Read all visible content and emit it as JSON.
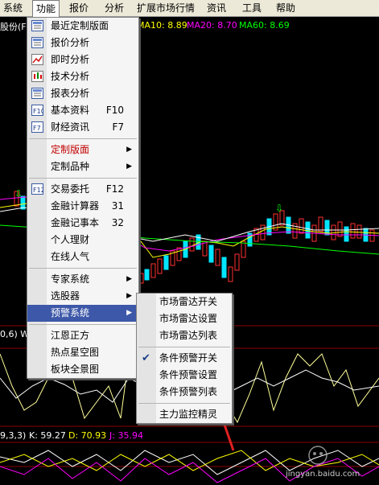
{
  "menubar": {
    "items": [
      "系统",
      "功能",
      "报价",
      "分析",
      "扩展市场行情",
      "资讯",
      "工具",
      "帮助"
    ],
    "active": "功能"
  },
  "chart_labels": {
    "stock": "股份(F",
    "ma10": "MA10: 8.89",
    "ma20": "MA20: 8.70",
    "ma60": "MA60: 8.69",
    "ind1": "0,6) W",
    "kdj_params": "9,3,3)",
    "k": "K: 59.27",
    "d": "D: 70.93",
    "j": "J: 35.94"
  },
  "colors": {
    "ma10": "#ffff00",
    "ma20": "#ff00ff",
    "ma60": "#00ff00",
    "highlight": "#3d58a8",
    "menu_red": "#c00000",
    "arrow": "#e02020"
  },
  "function_menu": {
    "items": [
      {
        "label": "最近定制版面",
        "icon": "layout-icon"
      },
      {
        "label": "报价分析",
        "icon": "quote-icon"
      },
      {
        "label": "即时分析",
        "icon": "line-chart-icon"
      },
      {
        "label": "技术分析",
        "icon": "candle-icon"
      },
      {
        "label": "报表分析",
        "icon": "report-icon"
      },
      {
        "label": "基本资料",
        "shortcut": "F10",
        "icon": "f10-icon"
      },
      {
        "label": "财经资讯",
        "shortcut": "F7",
        "icon": "f7-icon"
      },
      {
        "sep": true
      },
      {
        "label": "定制版面",
        "red": true,
        "submenu": true
      },
      {
        "label": "定制品种",
        "submenu": true
      },
      {
        "sep": true
      },
      {
        "label": "交易委托",
        "shortcut": "F12",
        "icon": "f12-icon"
      },
      {
        "label": "金融计算器",
        "shortcut": "31"
      },
      {
        "label": "金融记事本",
        "shortcut": "32"
      },
      {
        "label": "个人理财"
      },
      {
        "label": "在线人气"
      },
      {
        "sep": true
      },
      {
        "label": "专家系统",
        "submenu": true
      },
      {
        "label": "选股器",
        "submenu": true
      },
      {
        "label": "预警系统",
        "submenu": true,
        "highlight": true
      },
      {
        "sep": true
      },
      {
        "label": "江恩正方"
      },
      {
        "label": "热点星空图"
      },
      {
        "label": "板块全景图"
      }
    ]
  },
  "alert_submenu": {
    "items": [
      {
        "label": "市场雷达开关"
      },
      {
        "label": "市场雷达设置"
      },
      {
        "label": "市场雷达列表"
      },
      {
        "sep": true
      },
      {
        "label": "条件预警开关",
        "checked": true
      },
      {
        "label": "条件预警设置"
      },
      {
        "label": "条件预警列表"
      },
      {
        "sep": true
      },
      {
        "label": "主力监控精灵"
      }
    ]
  },
  "watermark": {
    "site": "jingyan.baidu.com"
  }
}
